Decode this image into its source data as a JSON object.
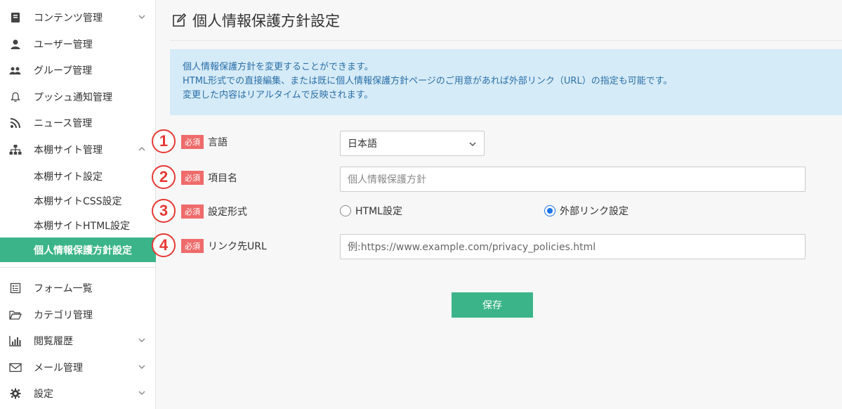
{
  "sidebar": {
    "items": [
      {
        "label": "コンテンツ管理",
        "icon": "book-icon"
      },
      {
        "label": "ユーザー管理",
        "icon": "user-icon"
      },
      {
        "label": "グループ管理",
        "icon": "group-icon"
      },
      {
        "label": "プッシュ通知管理",
        "icon": "bell-icon"
      },
      {
        "label": "ニュース管理",
        "icon": "rss-icon"
      },
      {
        "label": "本棚サイト管理",
        "icon": "sitemap-icon"
      }
    ],
    "sub_items": [
      {
        "label": "本棚サイト設定"
      },
      {
        "label": "本棚サイトCSS設定"
      },
      {
        "label": "本棚サイトHTML設定"
      },
      {
        "label": "個人情報保護方針設定"
      }
    ],
    "lower_items": [
      {
        "label": "フォーム一覧",
        "icon": "form-icon"
      },
      {
        "label": "カテゴリ管理",
        "icon": "folder-icon"
      },
      {
        "label": "閲覧履歴",
        "icon": "bar-chart-icon"
      },
      {
        "label": "メール管理",
        "icon": "mail-icon"
      },
      {
        "label": "設定",
        "icon": "gear-icon"
      }
    ]
  },
  "main": {
    "title": "個人情報保護方針設定",
    "info_lines": [
      "個人情報保護方針を変更することができます。",
      "HTML形式での直接編集、または既に個人情報保護方針ページのご用意があれば外部リンク（URL）の指定も可能です。",
      "変更した内容はリアルタイムで反映されます。"
    ],
    "required_badge": "必須",
    "fields": {
      "language": {
        "number": "1",
        "label": "言語",
        "value": "日本語"
      },
      "item_name": {
        "number": "2",
        "label": "項目名",
        "placeholder": "個人情報保護方針"
      },
      "format": {
        "number": "3",
        "label": "設定形式",
        "option_html": "HTML設定",
        "option_link": "外部リンク設定",
        "selected": "外部リンク設定"
      },
      "link_url": {
        "number": "4",
        "label": "リンク先URL",
        "placeholder": "例:https://www.example.com/privacy_policies.html"
      }
    },
    "save_label": "保存"
  },
  "colors": {
    "accent": "#3cb48a",
    "info_bg": "#d6ebf8",
    "info_text": "#2a6fa8",
    "required": "#ef6b6b",
    "annotation": "#e53935"
  }
}
